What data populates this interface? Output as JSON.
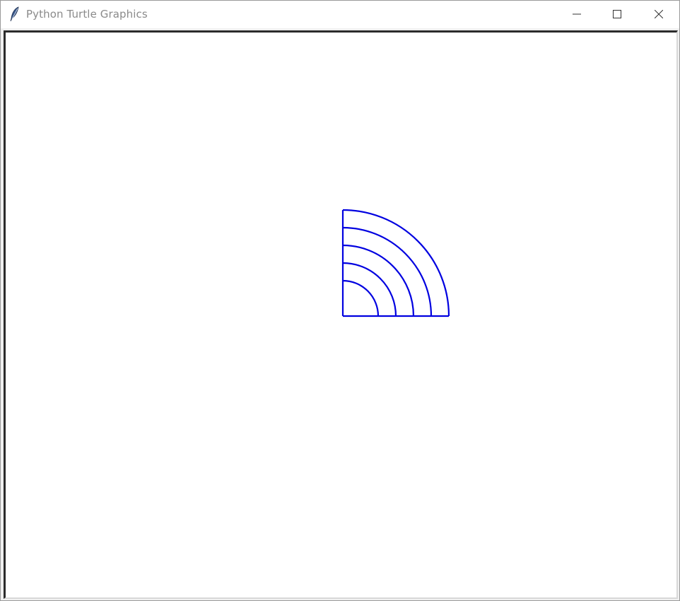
{
  "window": {
    "title": "Python Turtle Graphics",
    "app_icon": "feather-icon",
    "controls": [
      "minimize-icon",
      "maximize-icon",
      "close-icon"
    ]
  },
  "canvas": {
    "background": "#ffffff",
    "pen_color": "#0000e0",
    "drawing": {
      "shape": "concentric quarter-circle arcs",
      "radii": [
        50,
        75,
        100,
        125,
        150
      ]
    }
  }
}
